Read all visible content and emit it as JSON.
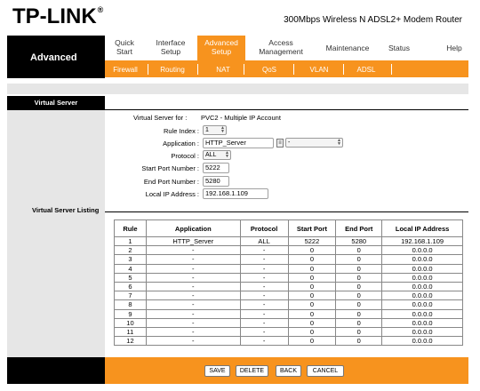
{
  "header": {
    "logo": "TP-LINK",
    "model": "300Mbps Wireless N ADSL2+ Modem Router"
  },
  "nav": {
    "section": "Advanced",
    "tabs": [
      {
        "label": "Quick Start"
      },
      {
        "label": "Interface Setup"
      },
      {
        "label": "Advanced Setup"
      },
      {
        "label": "Access Management"
      },
      {
        "label": "Maintenance"
      },
      {
        "label": "Status"
      },
      {
        "label": "Help"
      }
    ],
    "subtabs": [
      "Firewall",
      "Routing",
      "NAT",
      "QoS",
      "VLAN",
      "ADSL"
    ]
  },
  "virtual_server": {
    "section_title": "Virtual Server",
    "for_label": "Virtual Server for :",
    "for_value": "PVC2 - Multiple IP Account",
    "rule_index_label": "Rule Index :",
    "rule_index_value": "1",
    "application_label": "Application :",
    "application_value": "HTTP_Server",
    "application_select": "-",
    "protocol_label": "Protocol :",
    "protocol_value": "ALL",
    "start_port_label": "Start Port Number :",
    "start_port_value": "5222",
    "end_port_label": "End Port Number :",
    "end_port_value": "5280",
    "local_ip_label": "Local IP Address :",
    "local_ip_value": "192.168.1.109"
  },
  "listing": {
    "title": "Virtual Server Listing",
    "columns": [
      "Rule",
      "Application",
      "Protocol",
      "Start Port",
      "End Port",
      "Local IP Address"
    ],
    "rows": [
      [
        "1",
        "HTTP_Server",
        "ALL",
        "5222",
        "5280",
        "192.168.1.109"
      ],
      [
        "2",
        "-",
        "-",
        "0",
        "0",
        "0.0.0.0"
      ],
      [
        "3",
        "-",
        "-",
        "0",
        "0",
        "0.0.0.0"
      ],
      [
        "4",
        "-",
        "-",
        "0",
        "0",
        "0.0.0.0"
      ],
      [
        "5",
        "-",
        "-",
        "0",
        "0",
        "0.0.0.0"
      ],
      [
        "6",
        "-",
        "-",
        "0",
        "0",
        "0.0.0.0"
      ],
      [
        "7",
        "-",
        "-",
        "0",
        "0",
        "0.0.0.0"
      ],
      [
        "8",
        "-",
        "-",
        "0",
        "0",
        "0.0.0.0"
      ],
      [
        "9",
        "-",
        "-",
        "0",
        "0",
        "0.0.0.0"
      ],
      [
        "10",
        "-",
        "-",
        "0",
        "0",
        "0.0.0.0"
      ],
      [
        "11",
        "-",
        "-",
        "0",
        "0",
        "0.0.0.0"
      ],
      [
        "12",
        "-",
        "-",
        "0",
        "0",
        "0.0.0.0"
      ]
    ]
  },
  "buttons": {
    "save": "SAVE",
    "delete": "DELETE",
    "back": "BACK",
    "cancel": "CANCEL"
  },
  "colors": {
    "accent": "#f7931e",
    "dark": "#000000",
    "panel": "#e6e6e6"
  }
}
